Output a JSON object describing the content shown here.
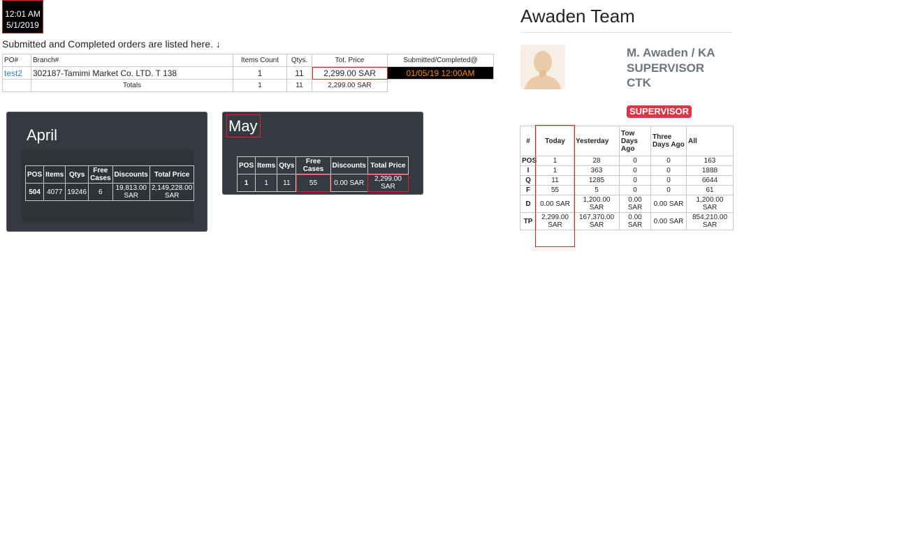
{
  "clock": {
    "time": "12:01 AM",
    "date": "5/1/2019"
  },
  "caption": "Submitted and Completed orders are listed here. ↓",
  "orders": {
    "headers": [
      "PO#",
      "Branch#",
      "Items Count",
      "Qtys.",
      "Tot. Price",
      "Submitted/Completed@"
    ],
    "row": {
      "po": "test2",
      "branch": "302187-Tamimi Market Co. LTD. T 138",
      "items": "1",
      "qtys": "11",
      "price": "2,299.00 SAR",
      "date": "01/05/19 12:00AM"
    },
    "totals": {
      "label": "Totals",
      "items": "1",
      "qtys": "11",
      "price": "2,299.00 SAR"
    }
  },
  "april": {
    "title": "April",
    "headers": [
      "POS",
      "Items",
      "Qtys",
      "Free Cases",
      "Discounts",
      "Total Price"
    ],
    "row": {
      "pos": "504",
      "items": "4077",
      "qtys": "19246",
      "free": "6",
      "discounts": "19,813.00 SAR",
      "total": "2,149,228.00 SAR"
    }
  },
  "may": {
    "title": "May",
    "headers": [
      "POS",
      "Items",
      "Qtys",
      "Free Cases",
      "Discounts",
      "Total Price"
    ],
    "row": {
      "pos": "1",
      "items": "1",
      "qtys": "11",
      "free": "55",
      "discounts": "0.00 SAR",
      "total": "2,299.00 SAR"
    }
  },
  "team": {
    "title": "Awaden Team",
    "member_name": "M. Awaden / KA SUPERVISOR CTK",
    "role": "SUPERVISOR",
    "stats": {
      "headers": [
        "#",
        "Today",
        "Yesterday",
        "Tow Days Ago",
        "Three Days Ago",
        "All"
      ],
      "rows": [
        {
          "label": "POS",
          "today": "1",
          "yesterday": "28",
          "two": "0",
          "three": "0",
          "all": "163"
        },
        {
          "label": "I",
          "today": "1",
          "yesterday": "363",
          "two": "0",
          "three": "0",
          "all": "1888"
        },
        {
          "label": "Q",
          "today": "11",
          "yesterday": "1285",
          "two": "0",
          "three": "0",
          "all": "6644"
        },
        {
          "label": "F",
          "today": "55",
          "yesterday": "5",
          "two": "0",
          "three": "0",
          "all": "61"
        },
        {
          "label": "D",
          "today": "0.00 SAR",
          "yesterday": "1,200.00 SAR",
          "two": "0.00 SAR",
          "three": "0.00 SAR",
          "all": "1,200.00 SAR"
        },
        {
          "label": "TP",
          "today": "2,299.00 SAR",
          "yesterday": "167,370.00 SAR",
          "two": "0.00 SAR",
          "three": "0.00 SAR",
          "all": "854,210.00 SAR"
        }
      ]
    }
  },
  "colors": {
    "accent_red": "#d9262b",
    "badge_red": "#dc3545",
    "card_bg": "#343a40",
    "link_blue": "#2f80c8",
    "date_orange": "#ff8a00"
  },
  "icons": {
    "avatar": "person-silhouette-icon"
  }
}
